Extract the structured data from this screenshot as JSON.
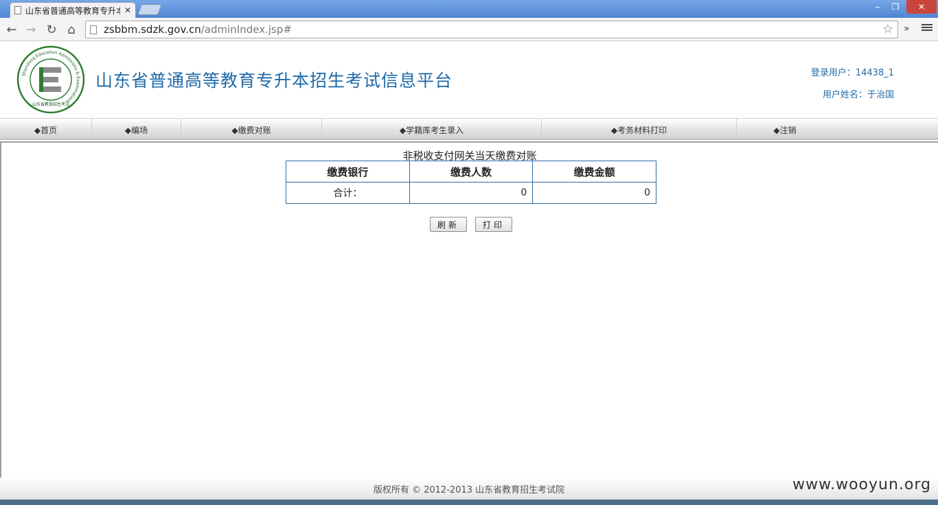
{
  "browser": {
    "tab_title": "山东省普通高等教育专升本",
    "tab_close": "✕",
    "url_host": "zsbbm.sdzk.gov.cn",
    "url_path": "/adminIndex.jsp#",
    "min": "‒",
    "max": "❐",
    "close": "✕",
    "back": "←",
    "forward": "→",
    "reload": "↻",
    "home": "⌂",
    "star": "☆",
    "more": "»"
  },
  "header": {
    "site_title": "山东省普通高等教育专升本招生考试信息平台",
    "login_user": "登录用户：14438_1",
    "user_name": "用户姓名：于治国",
    "logo_letter": "E",
    "logo_ring_text": "Shandong Education Admissions & Examinations",
    "logo_bottom_text": "山东省教育招生考试"
  },
  "nav": {
    "items": [
      "◆首页",
      "◆编场",
      "◆缴费对账",
      "◆学籍库考生录入",
      "◆考务材料打印",
      "◆注销"
    ]
  },
  "report": {
    "title": "非税收支付网关当天缴费对账",
    "headers": [
      "缴费银行",
      "缴费人数",
      "缴费金额"
    ],
    "total_label": "合计：",
    "total_count": "0",
    "total_amount": "0"
  },
  "buttons": {
    "refresh": "刷新",
    "print": "打印"
  },
  "footer": {
    "copyright": "版权所有 © 2012-2013 山东省教育招生考试院"
  },
  "watermark": "www.wooyun.org",
  "colors": {
    "brand_blue": "#1f6aa8",
    "table_border": "#2b6aa6"
  }
}
